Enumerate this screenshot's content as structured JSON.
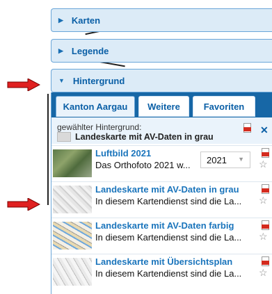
{
  "sections": {
    "karten": "Karten",
    "legende": "Legende",
    "hintergrund": "Hintergrund"
  },
  "tabs": [
    "Kanton Aargau",
    "Weitere",
    "Favoriten"
  ],
  "selected": {
    "label": "gewählter Hintergrund:",
    "value": "Landeskarte mit AV-Daten in grau"
  },
  "items": [
    {
      "title": "Luftbild 2021",
      "desc": "Das Orthofoto 2021 w...",
      "year": "2021"
    },
    {
      "title": "Landeskarte mit AV-Daten in grau",
      "desc": "In diesem Kartendienst sind die La..."
    },
    {
      "title": "Landeskarte mit AV-Daten farbig",
      "desc": "In diesem Kartendienst sind die La..."
    },
    {
      "title": "Landeskarte mit Übersichtsplan",
      "desc": "In diesem Kartendienst sind die La..."
    }
  ],
  "icons": {
    "expand": "caret-right-icon",
    "collapse": "caret-down-icon",
    "pdf": "pdf-icon",
    "favorite": "star-icon",
    "close": "close-icon",
    "annotation": "red-arrow-icon"
  },
  "colors": {
    "accent": "#1767a6",
    "link": "#1b75bc",
    "bar_bg": "#dcebf7",
    "arrow": "#e02020"
  }
}
